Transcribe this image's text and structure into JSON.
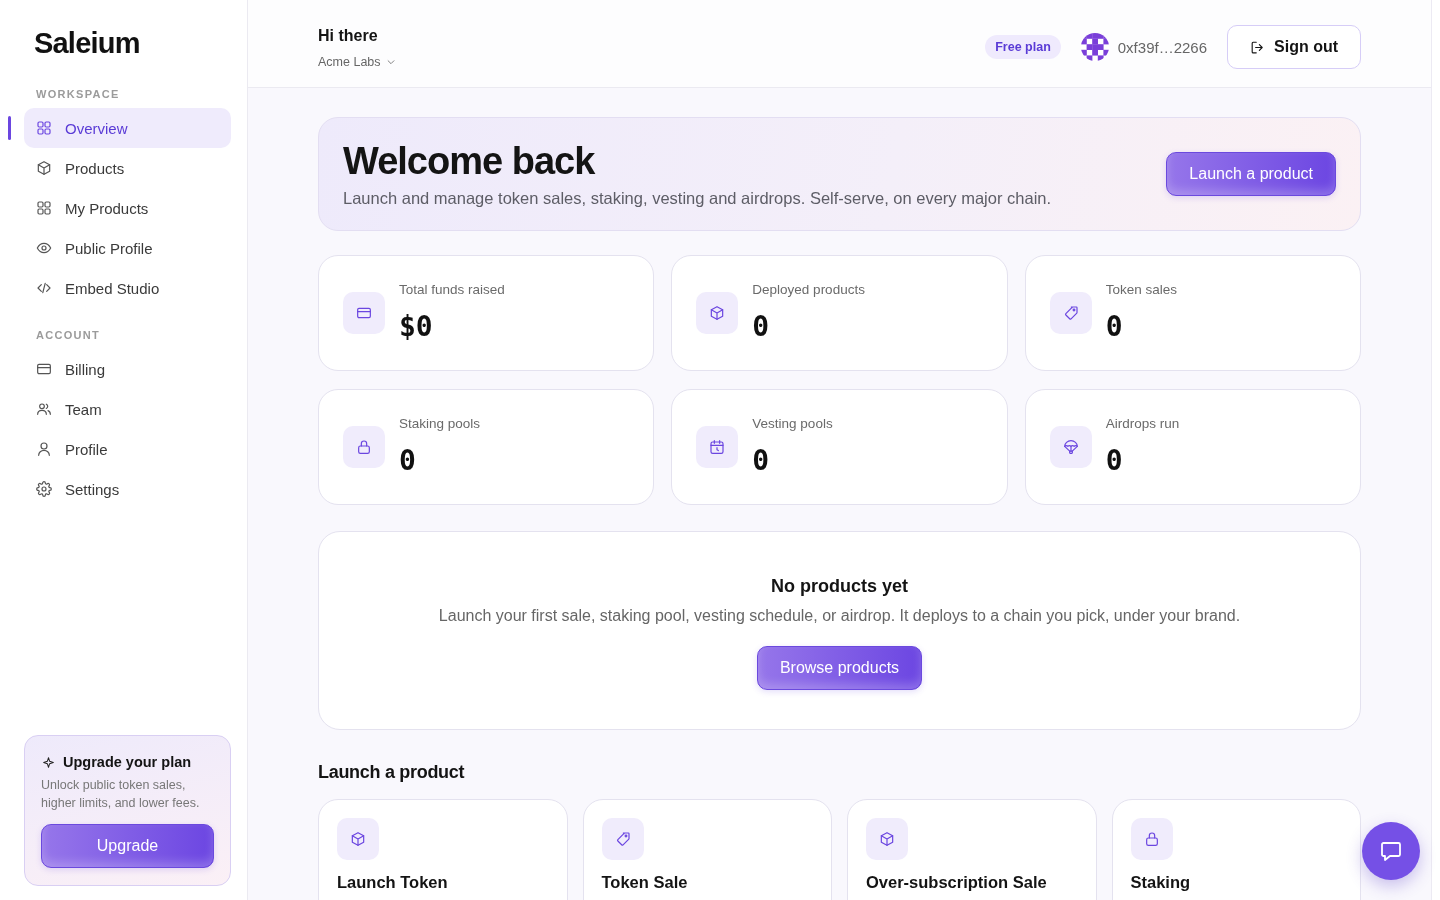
{
  "sidebar": {
    "logo": "Saleium",
    "sections": [
      {
        "label": "WORKSPACE",
        "items": [
          {
            "label": "Overview",
            "kind": "grid",
            "selected": true
          },
          {
            "label": "Products",
            "kind": "cube",
            "selected": false
          },
          {
            "label": "My Products",
            "kind": "grid",
            "selected": false
          },
          {
            "label": "Public Profile",
            "kind": "eye",
            "selected": false
          },
          {
            "label": "Embed Studio",
            "kind": "code",
            "selected": false
          }
        ]
      },
      {
        "label": "ACCOUNT",
        "items": [
          {
            "label": "Billing",
            "kind": "card",
            "selected": false
          },
          {
            "label": "Team",
            "kind": "people",
            "selected": false
          },
          {
            "label": "Profile",
            "kind": "person",
            "selected": false
          },
          {
            "label": "Settings",
            "kind": "gear",
            "selected": false
          }
        ]
      }
    ],
    "upgrade_card": {
      "title": "Upgrade your plan",
      "text": "Unlock public token sales, higher limits, and lower fees.",
      "button": "Upgrade"
    }
  },
  "header": {
    "greeting": "Hi there",
    "workspace": "Acme Labs",
    "plan_badge": "Free plan",
    "wallet_address": "0xf39f…2266",
    "sign_out": "Sign out"
  },
  "welcome": {
    "title": "Welcome back",
    "subtitle": "Launch and manage token sales, staking, vesting and airdrops. Self-serve, on every major chain.",
    "button": "Launch a product"
  },
  "stats": [
    {
      "label": "Total funds raised",
      "value": "$0",
      "kind": "card"
    },
    {
      "label": "Deployed products",
      "value": "0",
      "kind": "cube"
    },
    {
      "label": "Token sales",
      "value": "0",
      "kind": "tag"
    },
    {
      "label": "Staking pools",
      "value": "0",
      "kind": "lock"
    },
    {
      "label": "Vesting pools",
      "value": "0",
      "kind": "calendar"
    },
    {
      "label": "Airdrops run",
      "value": "0",
      "kind": "parachute"
    }
  ],
  "empty_state": {
    "title": "No products yet",
    "text": "Launch your first sale, staking pool, vesting schedule, or airdrop. It deploys to a chain you pick, under your brand.",
    "button": "Browse products"
  },
  "launch_section": {
    "title": "Launch a product",
    "products": [
      {
        "title": "Launch Token",
        "kind": "cube"
      },
      {
        "title": "Token Sale",
        "kind": "tag"
      },
      {
        "title": "Over-subscription Sale",
        "kind": "cube"
      },
      {
        "title": "Staking",
        "kind": "lock"
      }
    ]
  }
}
